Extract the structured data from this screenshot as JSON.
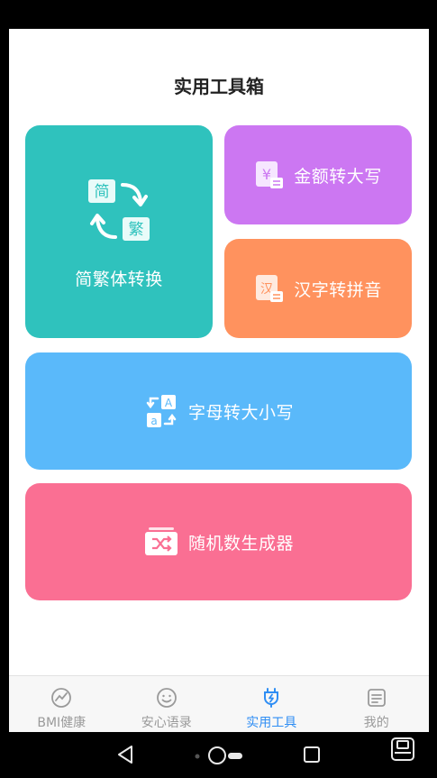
{
  "header": {
    "title": "实用工具箱"
  },
  "tools": {
    "jianfan": {
      "label": "简繁体转换",
      "badge_top": "简",
      "badge_bottom": "繁",
      "color": "#2fc2bd"
    },
    "jine": {
      "label": "金额转大写",
      "icon": "yen-icon",
      "color": "#cc77f2"
    },
    "pinyin": {
      "label": "汉字转拼音",
      "icon_char": "汉",
      "color": "#ff925e"
    },
    "zimu": {
      "label": "字母转大小写",
      "badge_upper": "A",
      "badge_lower": "a",
      "color": "#5ab9fa"
    },
    "suiji": {
      "label": "随机数生成器",
      "icon": "shuffle-icon",
      "color": "#fa6f93"
    }
  },
  "tabs": [
    {
      "label": "BMI健康",
      "icon": "heart-pulse-icon",
      "active": false
    },
    {
      "label": "安心语录",
      "icon": "smile-icon",
      "active": false
    },
    {
      "label": "实用工具",
      "icon": "plug-icon",
      "active": true
    },
    {
      "label": "我的",
      "icon": "profile-icon",
      "active": false
    }
  ],
  "colors": {
    "active_tab": "#2f8ef4",
    "inactive_tab": "#9a9a9a"
  }
}
